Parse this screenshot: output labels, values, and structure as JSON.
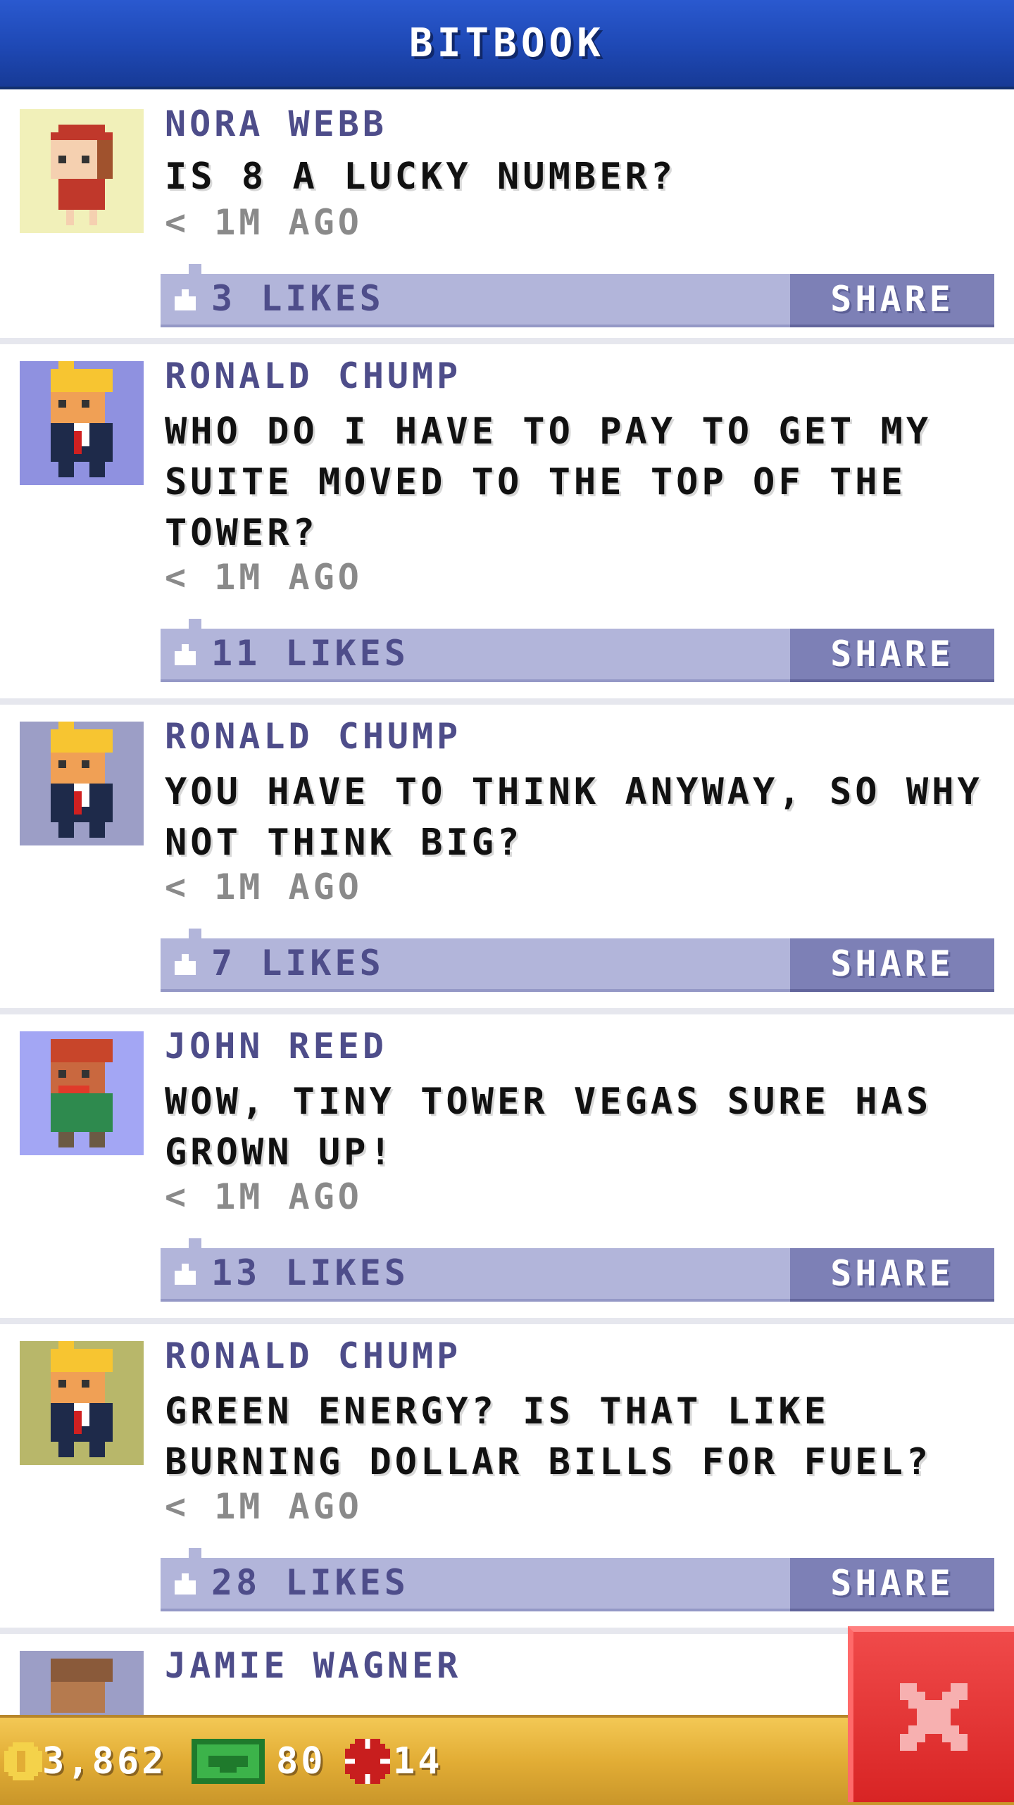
{
  "header": {
    "title": "BITBOOK"
  },
  "posts": [
    {
      "author": "NORA WEBB",
      "message": "IS 8 A LUCKY NUMBER?",
      "time": "< 1M AGO",
      "likes": "3 LIKES",
      "share_label": "SHARE",
      "avatar_bg": "#f1f0b9",
      "avatar_icon": "girl-red-hair-avatar-icon"
    },
    {
      "author": "RONALD CHUMP",
      "message": "WHO DO I HAVE TO PAY TO GET MY SUITE MOVED TO THE TOP OF THE TOWER?",
      "time": "< 1M AGO",
      "likes": "11 LIKES",
      "share_label": "SHARE",
      "avatar_bg": "#8f91e0",
      "avatar_icon": "blond-man-suit-avatar-icon"
    },
    {
      "author": "RONALD CHUMP",
      "message": "YOU HAVE TO THINK ANYWAY, SO WHY NOT THINK BIG?",
      "time": "< 1M AGO",
      "likes": "7 LIKES",
      "share_label": "SHARE",
      "avatar_bg": "#9c9ec6",
      "avatar_icon": "blond-man-suit-avatar-icon"
    },
    {
      "author": "JOHN REED",
      "message": "WOW, TINY TOWER VEGAS SURE HAS GROWN UP!",
      "time": "< 1M AGO",
      "likes": "13 LIKES",
      "share_label": "SHARE",
      "avatar_bg": "#a3a6f4",
      "avatar_icon": "red-hair-man-green-shirt-avatar-icon"
    },
    {
      "author": "RONALD CHUMP",
      "message": "GREEN ENERGY? IS THAT LIKE BURNING DOLLAR BILLS FOR FUEL?",
      "time": "< 1M AGO",
      "likes": "28 LIKES",
      "share_label": "SHARE",
      "avatar_bg": "#b8b76a",
      "avatar_icon": "blond-man-suit-avatar-icon"
    },
    {
      "author": "JAMIE WAGNER",
      "avatar_bg": "#9c9ec6",
      "avatar_icon": "brown-hair-avatar-icon"
    }
  ],
  "status": {
    "coins": "3,862",
    "bux": "80",
    "chips": "14"
  },
  "close_icon": "close-x-icon"
}
